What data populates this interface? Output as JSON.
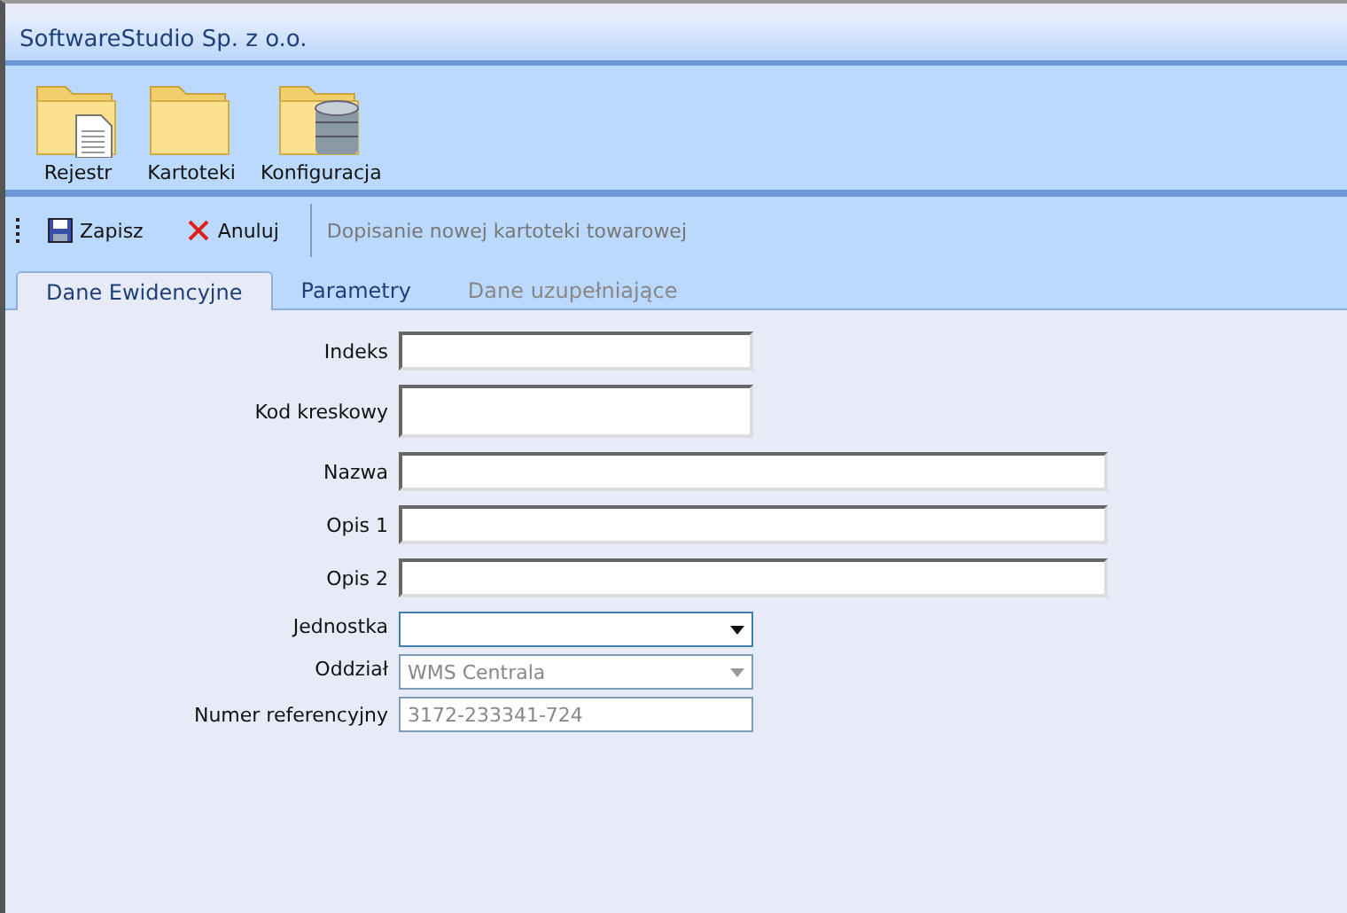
{
  "window": {
    "title": "SoftwareStudio Sp. z o.o."
  },
  "modules": [
    {
      "label": "Rejestr"
    },
    {
      "label": "Kartoteki"
    },
    {
      "label": "Konfiguracja"
    }
  ],
  "toolbar": {
    "buttons": [
      {
        "label": "Zapisz",
        "kind": "save"
      },
      {
        "label": "Anuluj",
        "kind": "cancel"
      }
    ],
    "caption": "Dopisanie nowej kartoteki towarowej"
  },
  "tabs": [
    {
      "label": "Dane Ewidencyjne",
      "selected": true,
      "disabled": false
    },
    {
      "label": "Parametry",
      "selected": false,
      "disabled": false
    },
    {
      "label": "Dane uzupełniające",
      "selected": false,
      "disabled": true
    }
  ],
  "fields": [
    {
      "label": "Indeks",
      "kind": "code"
    },
    {
      "label": "Kod kreskowy",
      "kind": "barcode"
    },
    {
      "label": "Nazwa",
      "kind": "line"
    },
    {
      "label": "Opis 1",
      "kind": "line"
    },
    {
      "label": "Opis 2",
      "kind": "line"
    },
    {
      "label": "Jednostka",
      "kind": "select",
      "disabled": false
    },
    {
      "label": "Oddział",
      "kind": "select",
      "value": "WMS Centrala",
      "disabled": true
    },
    {
      "label": "Numer referencyjny",
      "kind": "reference",
      "value": "3172-233341-724",
      "disabled": true
    }
  ]
}
